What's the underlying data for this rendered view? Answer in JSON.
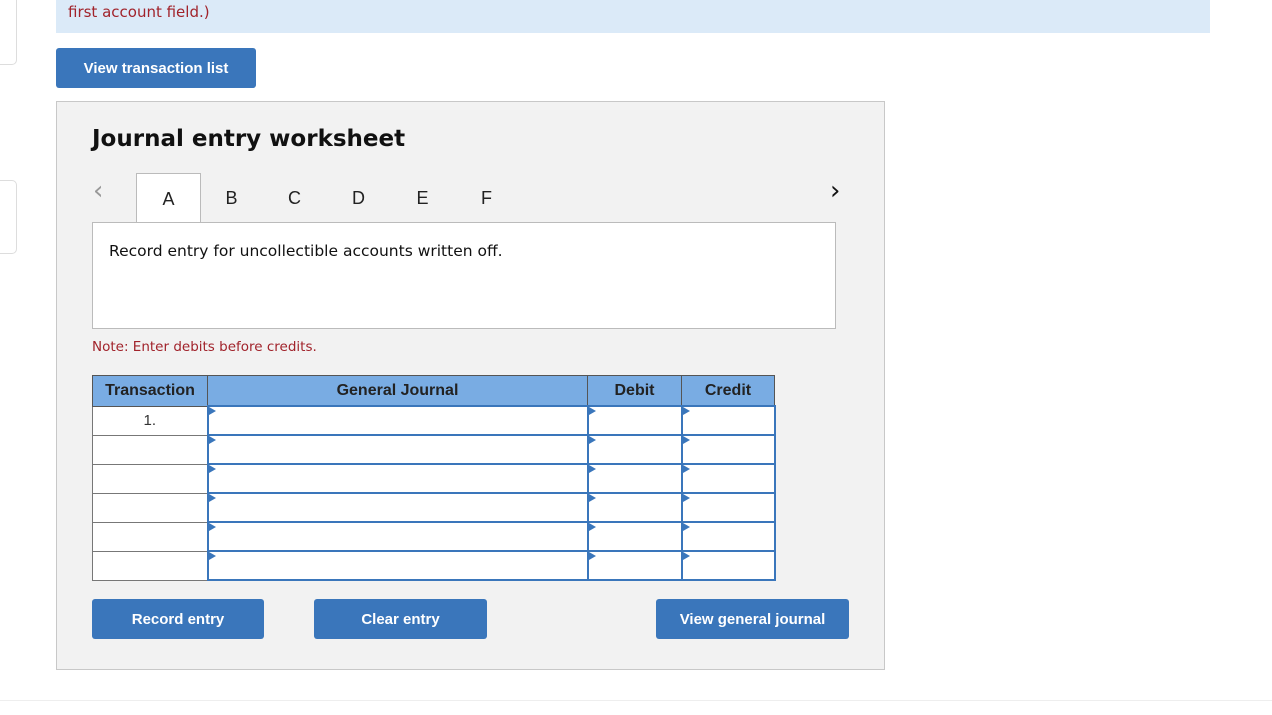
{
  "banner": {
    "text": "first account field.)"
  },
  "view_transaction_list": "View transaction list",
  "worksheet": {
    "title": "Journal entry worksheet",
    "tabs": [
      "A",
      "B",
      "C",
      "D",
      "E",
      "F"
    ],
    "active_tab": "A",
    "description": "Record entry for uncollectible accounts written off.",
    "note": "Note: Enter debits before credits.",
    "columns": [
      "Transaction",
      "General Journal",
      "Debit",
      "Credit"
    ],
    "rows": [
      {
        "transaction": "1."
      },
      {
        "transaction": ""
      },
      {
        "transaction": ""
      },
      {
        "transaction": ""
      },
      {
        "transaction": ""
      },
      {
        "transaction": ""
      }
    ],
    "buttons": {
      "record": "Record entry",
      "clear": "Clear entry",
      "view_journal": "View general journal"
    }
  }
}
